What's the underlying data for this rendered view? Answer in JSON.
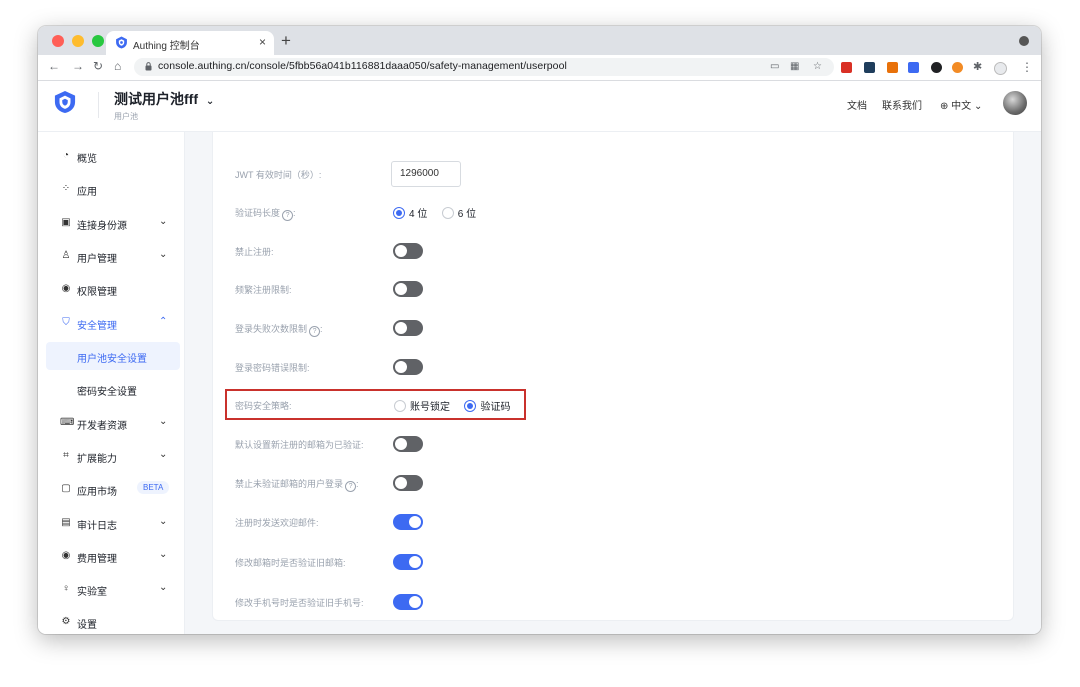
{
  "browser": {
    "tab_title": "Authing 控制台",
    "url": "console.authing.cn/console/5fbb56a041b116881daaa050/safety-management/userpool"
  },
  "header": {
    "pool_name": "测试用户池fff",
    "pool_subtitle": "用户池",
    "links": {
      "docs": "文档",
      "contact": "联系我们",
      "lang": "中文"
    }
  },
  "sidebar": {
    "items": [
      {
        "label": "概览"
      },
      {
        "label": "应用"
      },
      {
        "label": "连接身份源"
      },
      {
        "label": "用户管理"
      },
      {
        "label": "权限管理"
      },
      {
        "label": "安全管理"
      },
      {
        "label": "用户池安全设置"
      },
      {
        "label": "密码安全设置"
      },
      {
        "label": "开发者资源"
      },
      {
        "label": "扩展能力"
      },
      {
        "label": "应用市场",
        "badge": "BETA"
      },
      {
        "label": "审计日志"
      },
      {
        "label": "费用管理"
      },
      {
        "label": "实验室"
      },
      {
        "label": "设置"
      }
    ]
  },
  "settings": {
    "jwt_label": "JWT 有效时间（秒）:",
    "jwt_value": "1296000",
    "code_length_label": "验证码长度",
    "code_length_options": [
      "4 位",
      "6 位"
    ],
    "code_length_selected": "4 位",
    "disable_register_label": "禁止注册:",
    "register_limit_label": "频繁注册限制:",
    "login_fail_label": "登录失败次数限制",
    "pwd_error_label": "登录密码错误限制:",
    "pwd_policy_label": "密码安全策略:",
    "pwd_policy_options": [
      "账号锁定",
      "验证码"
    ],
    "pwd_policy_selected": "验证码",
    "email_verified_label": "默认设置新注册的邮箱为已验证:",
    "block_unverified_label": "禁止未验证邮箱的用户登录",
    "welcome_email_label": "注册时发送欢迎邮件:",
    "verify_old_email_label": "修改邮箱时是否验证旧邮箱:",
    "verify_old_phone_label": "修改手机号时是否验证旧手机号:",
    "toggles": {
      "disable_register": false,
      "register_limit": false,
      "login_fail": false,
      "pwd_error": false,
      "email_verified": false,
      "block_unverified": false,
      "welcome_email": true,
      "verify_old_email": true,
      "verify_old_phone": true
    }
  },
  "colors": {
    "accent": "#3d6af2",
    "highlight_border": "#c9312c",
    "toggle_off": "#606266"
  }
}
